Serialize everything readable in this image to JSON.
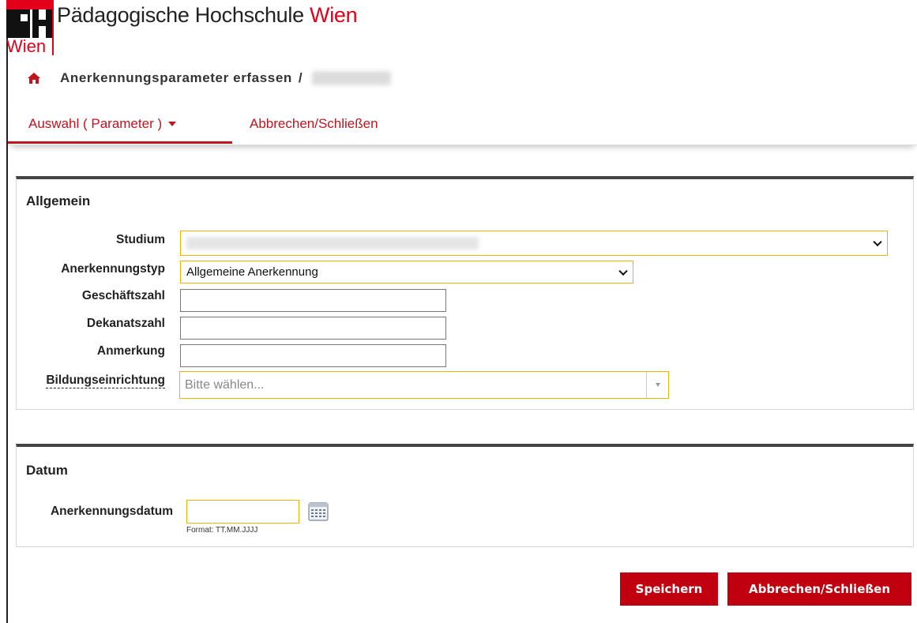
{
  "header": {
    "logo_text": "PH",
    "logo_city": "Wien",
    "school_name_main": "Pädagogische Hochschule",
    "school_name_city": "Wien"
  },
  "breadcrumb": {
    "title": "Anerkennungsparameter erfassen",
    "separator": "/"
  },
  "nav": {
    "tabs": [
      {
        "label": "Auswahl ( Parameter )"
      },
      {
        "label": "Abbrechen/Schließen"
      }
    ]
  },
  "allgemein": {
    "title": "Allgemein",
    "fields": {
      "studium": {
        "label": "Studium"
      },
      "anerkennungstyp": {
        "label": "Anerkennungstyp",
        "value": "Allgemeine Anerkennung"
      },
      "geschaeftszahl": {
        "label": "Geschäftszahl",
        "value": ""
      },
      "dekanatszahl": {
        "label": "Dekanatszahl",
        "value": ""
      },
      "anmerkung": {
        "label": "Anmerkung",
        "value": ""
      },
      "bildungseinrichtung": {
        "label": "Bildungseinrichtung",
        "placeholder": "Bitte wählen..."
      }
    }
  },
  "datum": {
    "title": "Datum",
    "anerkennungsdatum": {
      "label": "Anerkennungsdatum",
      "value": "",
      "format_hint": "Format: TT.MM.JJJJ"
    }
  },
  "buttons": {
    "save": "Speichern",
    "cancel": "Abbrechen/Schließen"
  },
  "colors": {
    "brand_red": "#c0000f",
    "focus_yellow": "#f0b400"
  }
}
